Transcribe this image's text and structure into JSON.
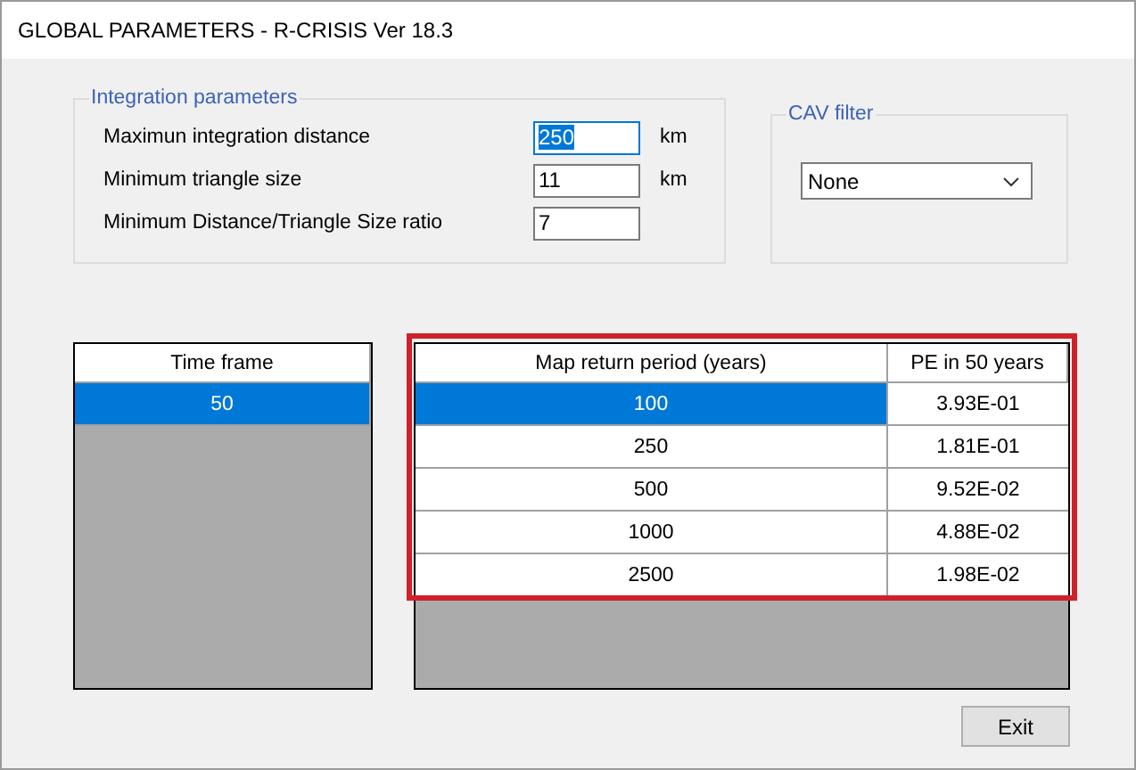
{
  "window": {
    "title": "GLOBAL PARAMETERS - R-CRISIS Ver 18.3"
  },
  "integration_parameters": {
    "title": "Integration parameters",
    "fields": [
      {
        "label": "Maximun integration distance",
        "value": "250",
        "unit": "km",
        "text_selected": true
      },
      {
        "label": "Minimum triangle size",
        "value": "11",
        "unit": "km",
        "text_selected": false
      },
      {
        "label": "Minimum Distance/Triangle Size ratio",
        "value": "7",
        "text_selected": false
      }
    ]
  },
  "cav_filter": {
    "title": "CAV filter",
    "value": "None"
  },
  "time_frame_table": {
    "columns": [
      "Time frame"
    ],
    "rows": [
      {
        "cells": [
          "50"
        ],
        "selected": true
      }
    ]
  },
  "return_period_table": {
    "highlighted": true,
    "columns": [
      "Map return period (years)",
      "PE in 50 years"
    ],
    "rows": [
      {
        "cells": [
          "100",
          "3.93E-01"
        ],
        "selected": true
      },
      {
        "cells": [
          "250",
          "1.81E-01"
        ],
        "selected": false
      },
      {
        "cells": [
          "500",
          "9.52E-02"
        ],
        "selected": false
      },
      {
        "cells": [
          "1000",
          "4.88E-02"
        ],
        "selected": false
      },
      {
        "cells": [
          "2500",
          "1.98E-02"
        ],
        "selected": false
      }
    ]
  },
  "buttons": [
    "Exit"
  ]
}
